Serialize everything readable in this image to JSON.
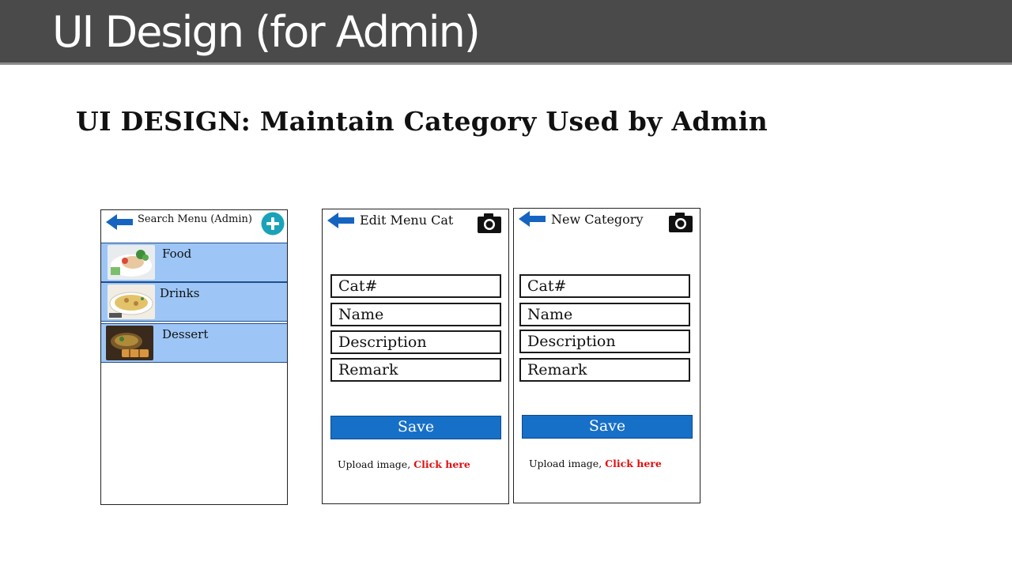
{
  "slide": {
    "title": "UI Design (for Admin)",
    "heading": "UI DESIGN: Maintain Category Used by Admin"
  },
  "search_screen": {
    "title": "Search Menu (Admin)",
    "back_icon": "back-arrow-icon",
    "add_icon": "add-circle-icon",
    "accent_color": "#1aa3b8",
    "items": [
      {
        "label": "Food"
      },
      {
        "label": "Drinks"
      },
      {
        "label": "Dessert"
      }
    ]
  },
  "edit_screen": {
    "title": "Edit Menu Cat",
    "camera_icon": "camera-icon",
    "fields": [
      {
        "placeholder": "Cat#"
      },
      {
        "placeholder": "Name"
      },
      {
        "placeholder": "Description"
      },
      {
        "placeholder": "Remark"
      }
    ],
    "save_label": "Save",
    "upload_text": "Upload image,",
    "upload_link": "Click here"
  },
  "new_screen": {
    "title": "New Category",
    "camera_icon": "camera-icon",
    "fields": [
      {
        "placeholder": "Cat#"
      },
      {
        "placeholder": "Name"
      },
      {
        "placeholder": "Description"
      },
      {
        "placeholder": "Remark"
      }
    ],
    "save_label": "Save",
    "upload_text": "Upload image,",
    "upload_link": "Click here"
  },
  "colors": {
    "title_bar": "#4a4a4a",
    "row_fill": "#9dc6f6",
    "arrow_blue": "#1565c0",
    "button_blue": "#1770c8",
    "link_red": "#e01010"
  }
}
